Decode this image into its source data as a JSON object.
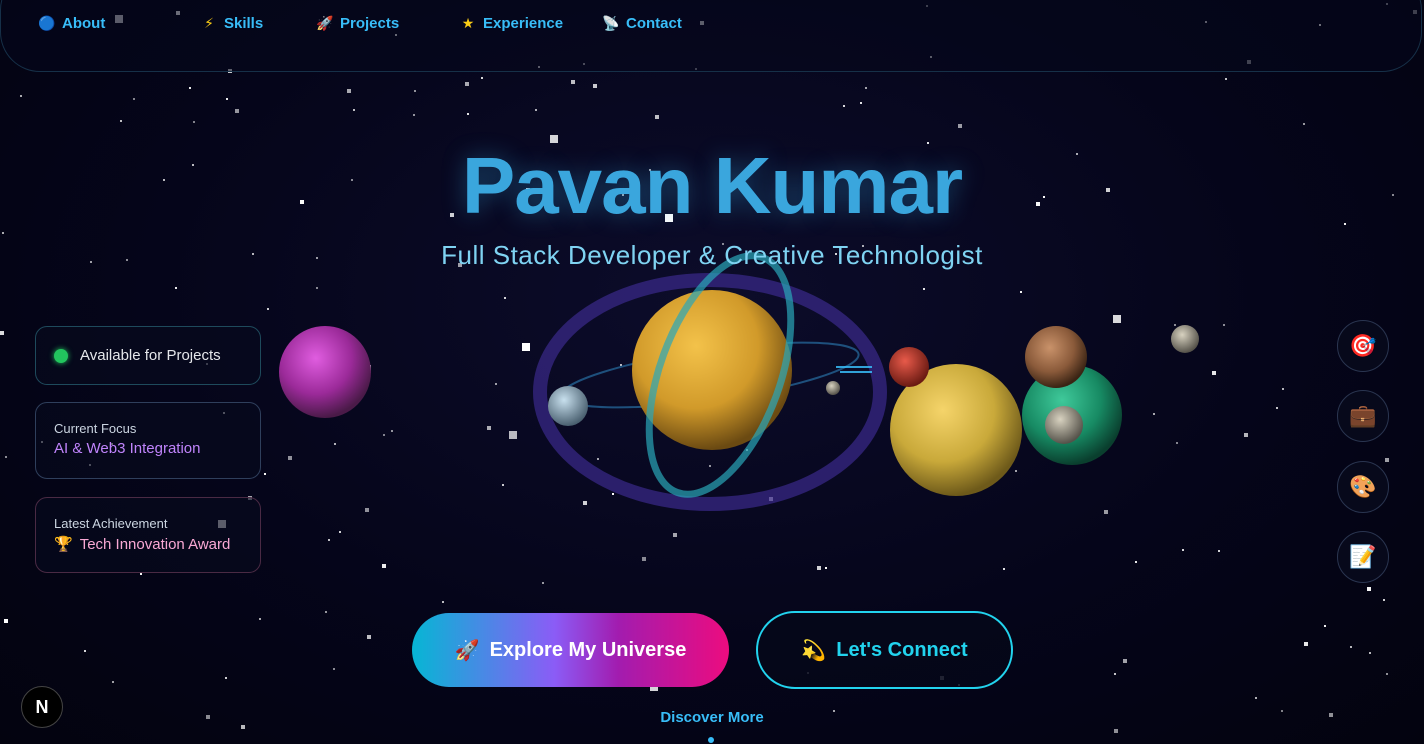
{
  "nav": {
    "items": [
      {
        "label": "About",
        "icon": "🔵"
      },
      {
        "label": "Skills",
        "icon": "⚡"
      },
      {
        "label": "Projects",
        "icon": "🚀"
      },
      {
        "label": "Experience",
        "icon": "★"
      },
      {
        "label": "Contact",
        "icon": "📡"
      }
    ]
  },
  "hero": {
    "name": "Pavan Kumar",
    "subtitle": "Full Stack Developer & Creative Technologist"
  },
  "cards": {
    "status": "Available for Projects",
    "focus_label": "Current Focus",
    "focus_value": "AI & Web3 Integration",
    "achievement_label": "Latest Achievement",
    "achievement_icon": "🏆",
    "achievement_value": "Tech Innovation Award"
  },
  "side_buttons": [
    {
      "icon": "🎯",
      "name": "target-icon"
    },
    {
      "icon": "💼",
      "name": "briefcase-icon"
    },
    {
      "icon": "🎨",
      "name": "palette-icon"
    },
    {
      "icon": "📝",
      "name": "memo-icon"
    }
  ],
  "cta": {
    "explore_icon": "🚀",
    "explore_label": "Explore My Universe",
    "connect_icon": "💫",
    "connect_label": "Let's Connect",
    "discover_label": "Discover More"
  },
  "badge": {
    "label": "N"
  },
  "colors": {
    "accent": "#38bdf8",
    "status_green": "#22c55e",
    "focus_purple": "#c084fc",
    "achievement_pink": "#f9a8d4"
  }
}
